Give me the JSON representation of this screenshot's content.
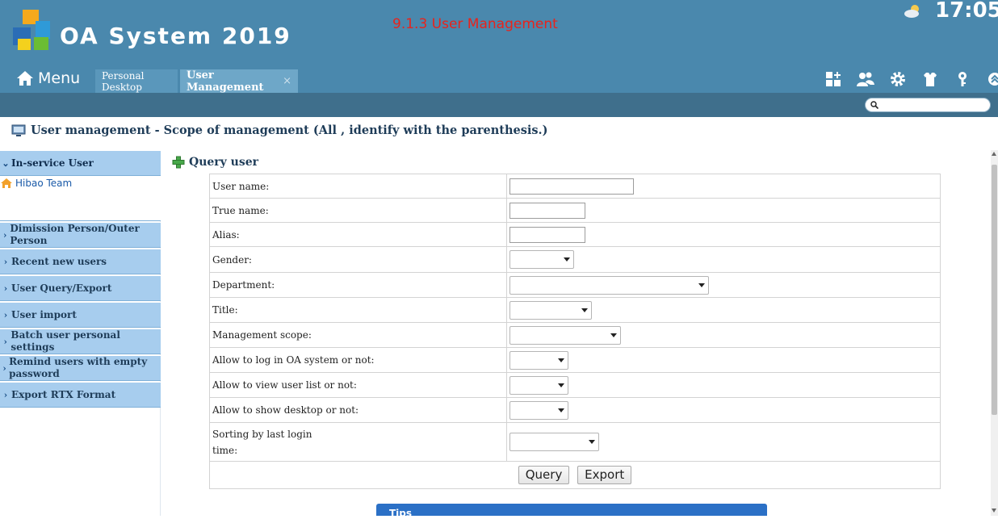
{
  "header": {
    "app_title": "OA System 2019",
    "page_caption": "9.1.3 User Management",
    "clock": "17:05",
    "menu_label": "Menu",
    "icons": [
      "weather-icon",
      "add-widget-icon",
      "users-icon",
      "gear-icon",
      "shirt-icon",
      "key-icon",
      "collapse-up-icon"
    ],
    "accent_colors": {
      "top_bar": "#4a88ad",
      "sub_bar": "#3f6f8c",
      "caption": "#e8231c"
    }
  },
  "tabs": [
    {
      "label": "Personal Desktop",
      "active": false
    },
    {
      "label": "User Management",
      "active": true,
      "close": "×"
    }
  ],
  "search": {
    "placeholder": "",
    "value": ""
  },
  "page_heading": "User management - Scope of management (All , identify with the parenthesis.)",
  "sidebar": {
    "open_section": "In-service User",
    "tree_item": "Hibao Team",
    "sections": [
      "Dimission Person/Outer Person",
      "Recent new users",
      "User Query/Export",
      "User import",
      "Batch user personal settings",
      "Remind users with empty password",
      "Export RTX Format"
    ]
  },
  "query": {
    "title": "Query user",
    "fields": [
      {
        "label": "User name:",
        "type": "text",
        "value": ""
      },
      {
        "label": "True name:",
        "type": "text",
        "value": ""
      },
      {
        "label": "Alias:",
        "type": "text",
        "value": ""
      },
      {
        "label": "Gender:",
        "type": "select",
        "value": ""
      },
      {
        "label": "Department:",
        "type": "select",
        "value": ""
      },
      {
        "label": "Title:",
        "type": "select",
        "value": ""
      },
      {
        "label": "Management scope:",
        "type": "select",
        "value": ""
      },
      {
        "label": "Allow to log in OA system or not:",
        "type": "select",
        "value": ""
      },
      {
        "label": "Allow to view user list or not:",
        "type": "select",
        "value": ""
      },
      {
        "label": "Allow to show desktop or not:",
        "type": "select",
        "value": ""
      },
      {
        "label_line1": "Sorting by last login",
        "label_line2": "time:",
        "type": "select",
        "value": ""
      }
    ],
    "buttons": {
      "query": "Query",
      "export": "Export"
    }
  },
  "tips": {
    "title": "Tips"
  }
}
